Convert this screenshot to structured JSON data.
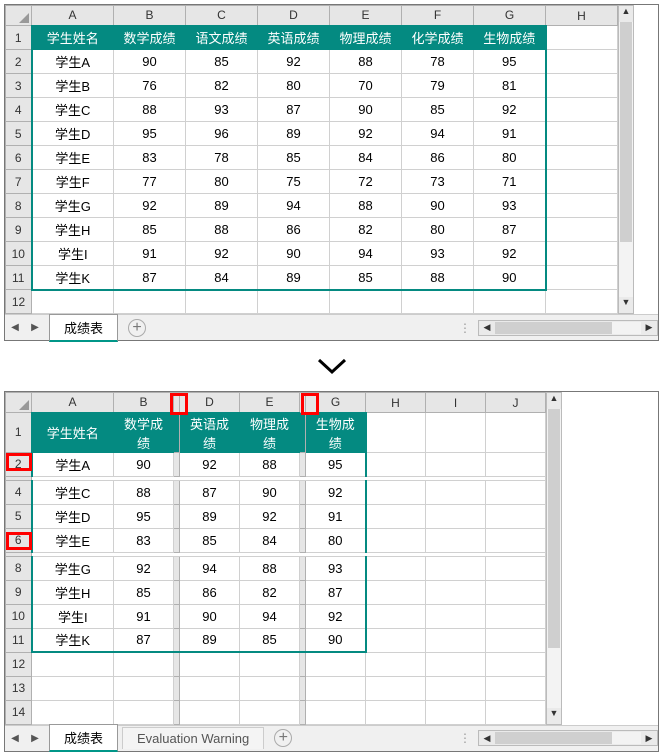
{
  "top": {
    "col_letters": [
      "A",
      "B",
      "C",
      "D",
      "E",
      "F",
      "G",
      "H"
    ],
    "row_nums": [
      "1",
      "2",
      "3",
      "4",
      "5",
      "6",
      "7",
      "8",
      "9",
      "10",
      "11",
      "12"
    ],
    "header": [
      "学生姓名",
      "数学成绩",
      "语文成绩",
      "英语成绩",
      "物理成绩",
      "化学成绩",
      "生物成绩"
    ],
    "rows": [
      [
        "学生A",
        "90",
        "85",
        "92",
        "88",
        "78",
        "95"
      ],
      [
        "学生B",
        "76",
        "82",
        "80",
        "70",
        "79",
        "81"
      ],
      [
        "学生C",
        "88",
        "93",
        "87",
        "90",
        "85",
        "92"
      ],
      [
        "学生D",
        "95",
        "96",
        "89",
        "92",
        "94",
        "91"
      ],
      [
        "学生E",
        "83",
        "78",
        "85",
        "84",
        "86",
        "80"
      ],
      [
        "学生F",
        "77",
        "80",
        "75",
        "72",
        "73",
        "71"
      ],
      [
        "学生G",
        "92",
        "89",
        "94",
        "88",
        "90",
        "93"
      ],
      [
        "学生H",
        "85",
        "88",
        "86",
        "82",
        "80",
        "87"
      ],
      [
        "学生I",
        "91",
        "92",
        "90",
        "94",
        "93",
        "92"
      ],
      [
        "学生K",
        "87",
        "84",
        "89",
        "85",
        "88",
        "90"
      ]
    ],
    "tab_name": "成绩表"
  },
  "bottom": {
    "col_letters_groups": [
      {
        "letters": [
          "A",
          "B"
        ],
        "widths": [
          82,
          60
        ]
      },
      {
        "gap": true
      },
      {
        "letters": [
          "D",
          "E"
        ],
        "widths": [
          60,
          60
        ]
      },
      {
        "gap": true
      },
      {
        "letters": [
          "G",
          "H",
          "I",
          "J"
        ],
        "widths": [
          60,
          60,
          60,
          60
        ]
      }
    ],
    "row_nums": [
      "1",
      "2",
      "4",
      "5",
      "6",
      "8",
      "9",
      "10",
      "11",
      "12",
      "13",
      "14"
    ],
    "header": [
      "学生姓名",
      "数学成绩",
      "英语成绩",
      "物理成绩",
      "生物成绩"
    ],
    "rows": [
      [
        "学生A",
        "90",
        "92",
        "88",
        "95"
      ],
      [
        "学生C",
        "88",
        "87",
        "90",
        "92"
      ],
      [
        "学生D",
        "95",
        "89",
        "92",
        "91"
      ],
      [
        "学生E",
        "83",
        "85",
        "84",
        "80"
      ],
      [
        "学生G",
        "92",
        "94",
        "88",
        "93"
      ],
      [
        "学生H",
        "85",
        "86",
        "82",
        "87"
      ],
      [
        "学生I",
        "91",
        "90",
        "94",
        "92"
      ],
      [
        "学生K",
        "87",
        "89",
        "85",
        "90"
      ]
    ],
    "tab_name": "成绩表",
    "tab2_name": "Evaluation Warning"
  },
  "chevron": "❯"
}
